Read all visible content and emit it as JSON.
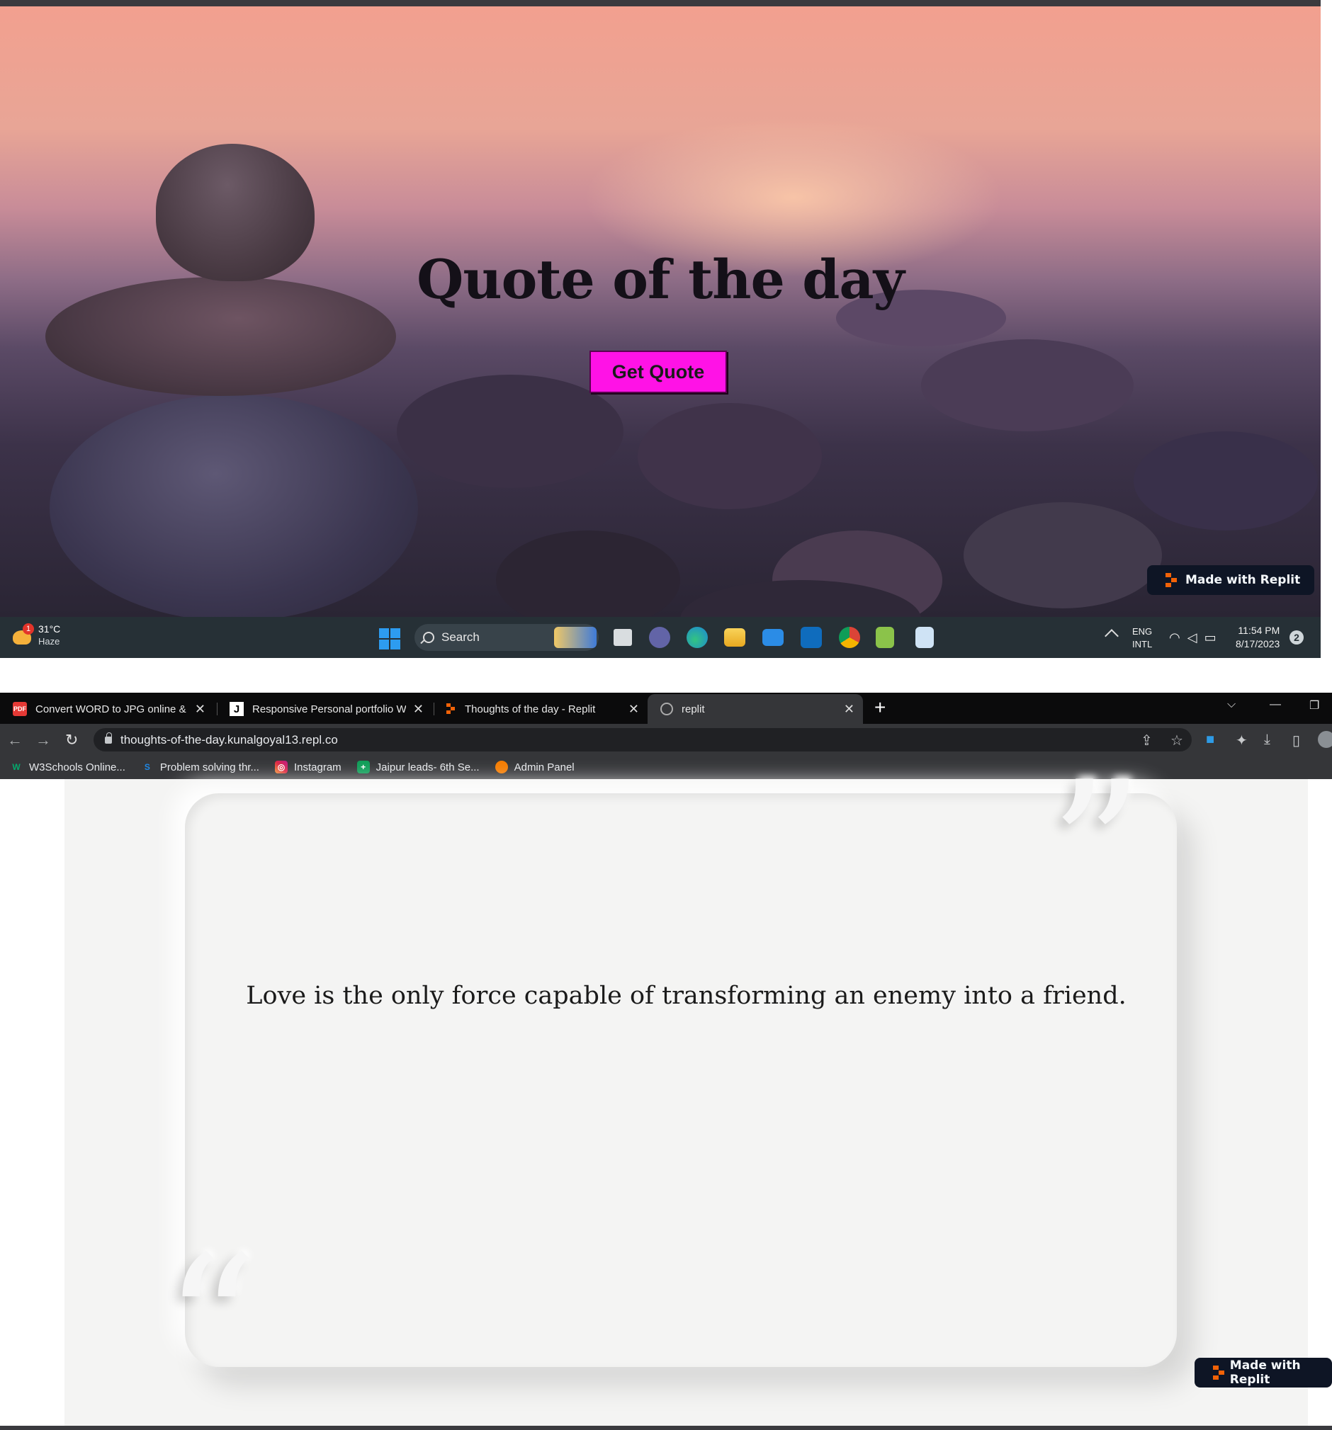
{
  "hero": {
    "title": "Quote of the day",
    "button_label": "Get Quote",
    "accent_color": "#ff12e6",
    "replit_badge": "Made with Replit"
  },
  "taskbar": {
    "weather_temp": "31°C",
    "weather_desc": "Haze",
    "weather_badge": "1",
    "search_label": "Search",
    "lang_top": "ENG",
    "lang_bottom": "INTL",
    "time": "11:54 PM",
    "date": "8/17/2023",
    "apps": [
      "widgets-icon",
      "task-view-icon",
      "teams-icon",
      "edge-icon",
      "file-explorer-icon",
      "mail-icon",
      "outlook-icon",
      "chrome-icon",
      "notepad-plus-icon",
      "notepad-icon"
    ]
  },
  "browser": {
    "tabs": [
      {
        "title": "Convert WORD to JPG online & free",
        "favicon": "PDF",
        "active": false
      },
      {
        "title": "Responsive Personal portfolio Website",
        "favicon": "J",
        "active": false
      },
      {
        "title": "Thoughts of the day - Replit",
        "favicon": "replit",
        "active": false
      },
      {
        "title": "replit",
        "favicon": "globe",
        "active": true
      }
    ],
    "url": "thoughts-of-the-day.kunalgoyal13.repl.co",
    "bookmarks": [
      {
        "label": "W3Schools Online...",
        "icon": "w3schools-icon",
        "color": "#04aa6d"
      },
      {
        "label": "Problem solving thr...",
        "icon": "s-icon",
        "color": "#1e88e5"
      },
      {
        "label": "Instagram",
        "icon": "instagram-icon",
        "color": "#e1306c"
      },
      {
        "label": "Jaipur leads- 6th Se...",
        "icon": "sheets-icon",
        "color": "#0f9d58"
      },
      {
        "label": "Admin Panel",
        "icon": "admin-icon",
        "color": "#f57c00"
      }
    ]
  },
  "quote": {
    "text": "Love is the only force capable of transforming an enemy into a friend.",
    "replit_badge": "Made with Replit"
  }
}
